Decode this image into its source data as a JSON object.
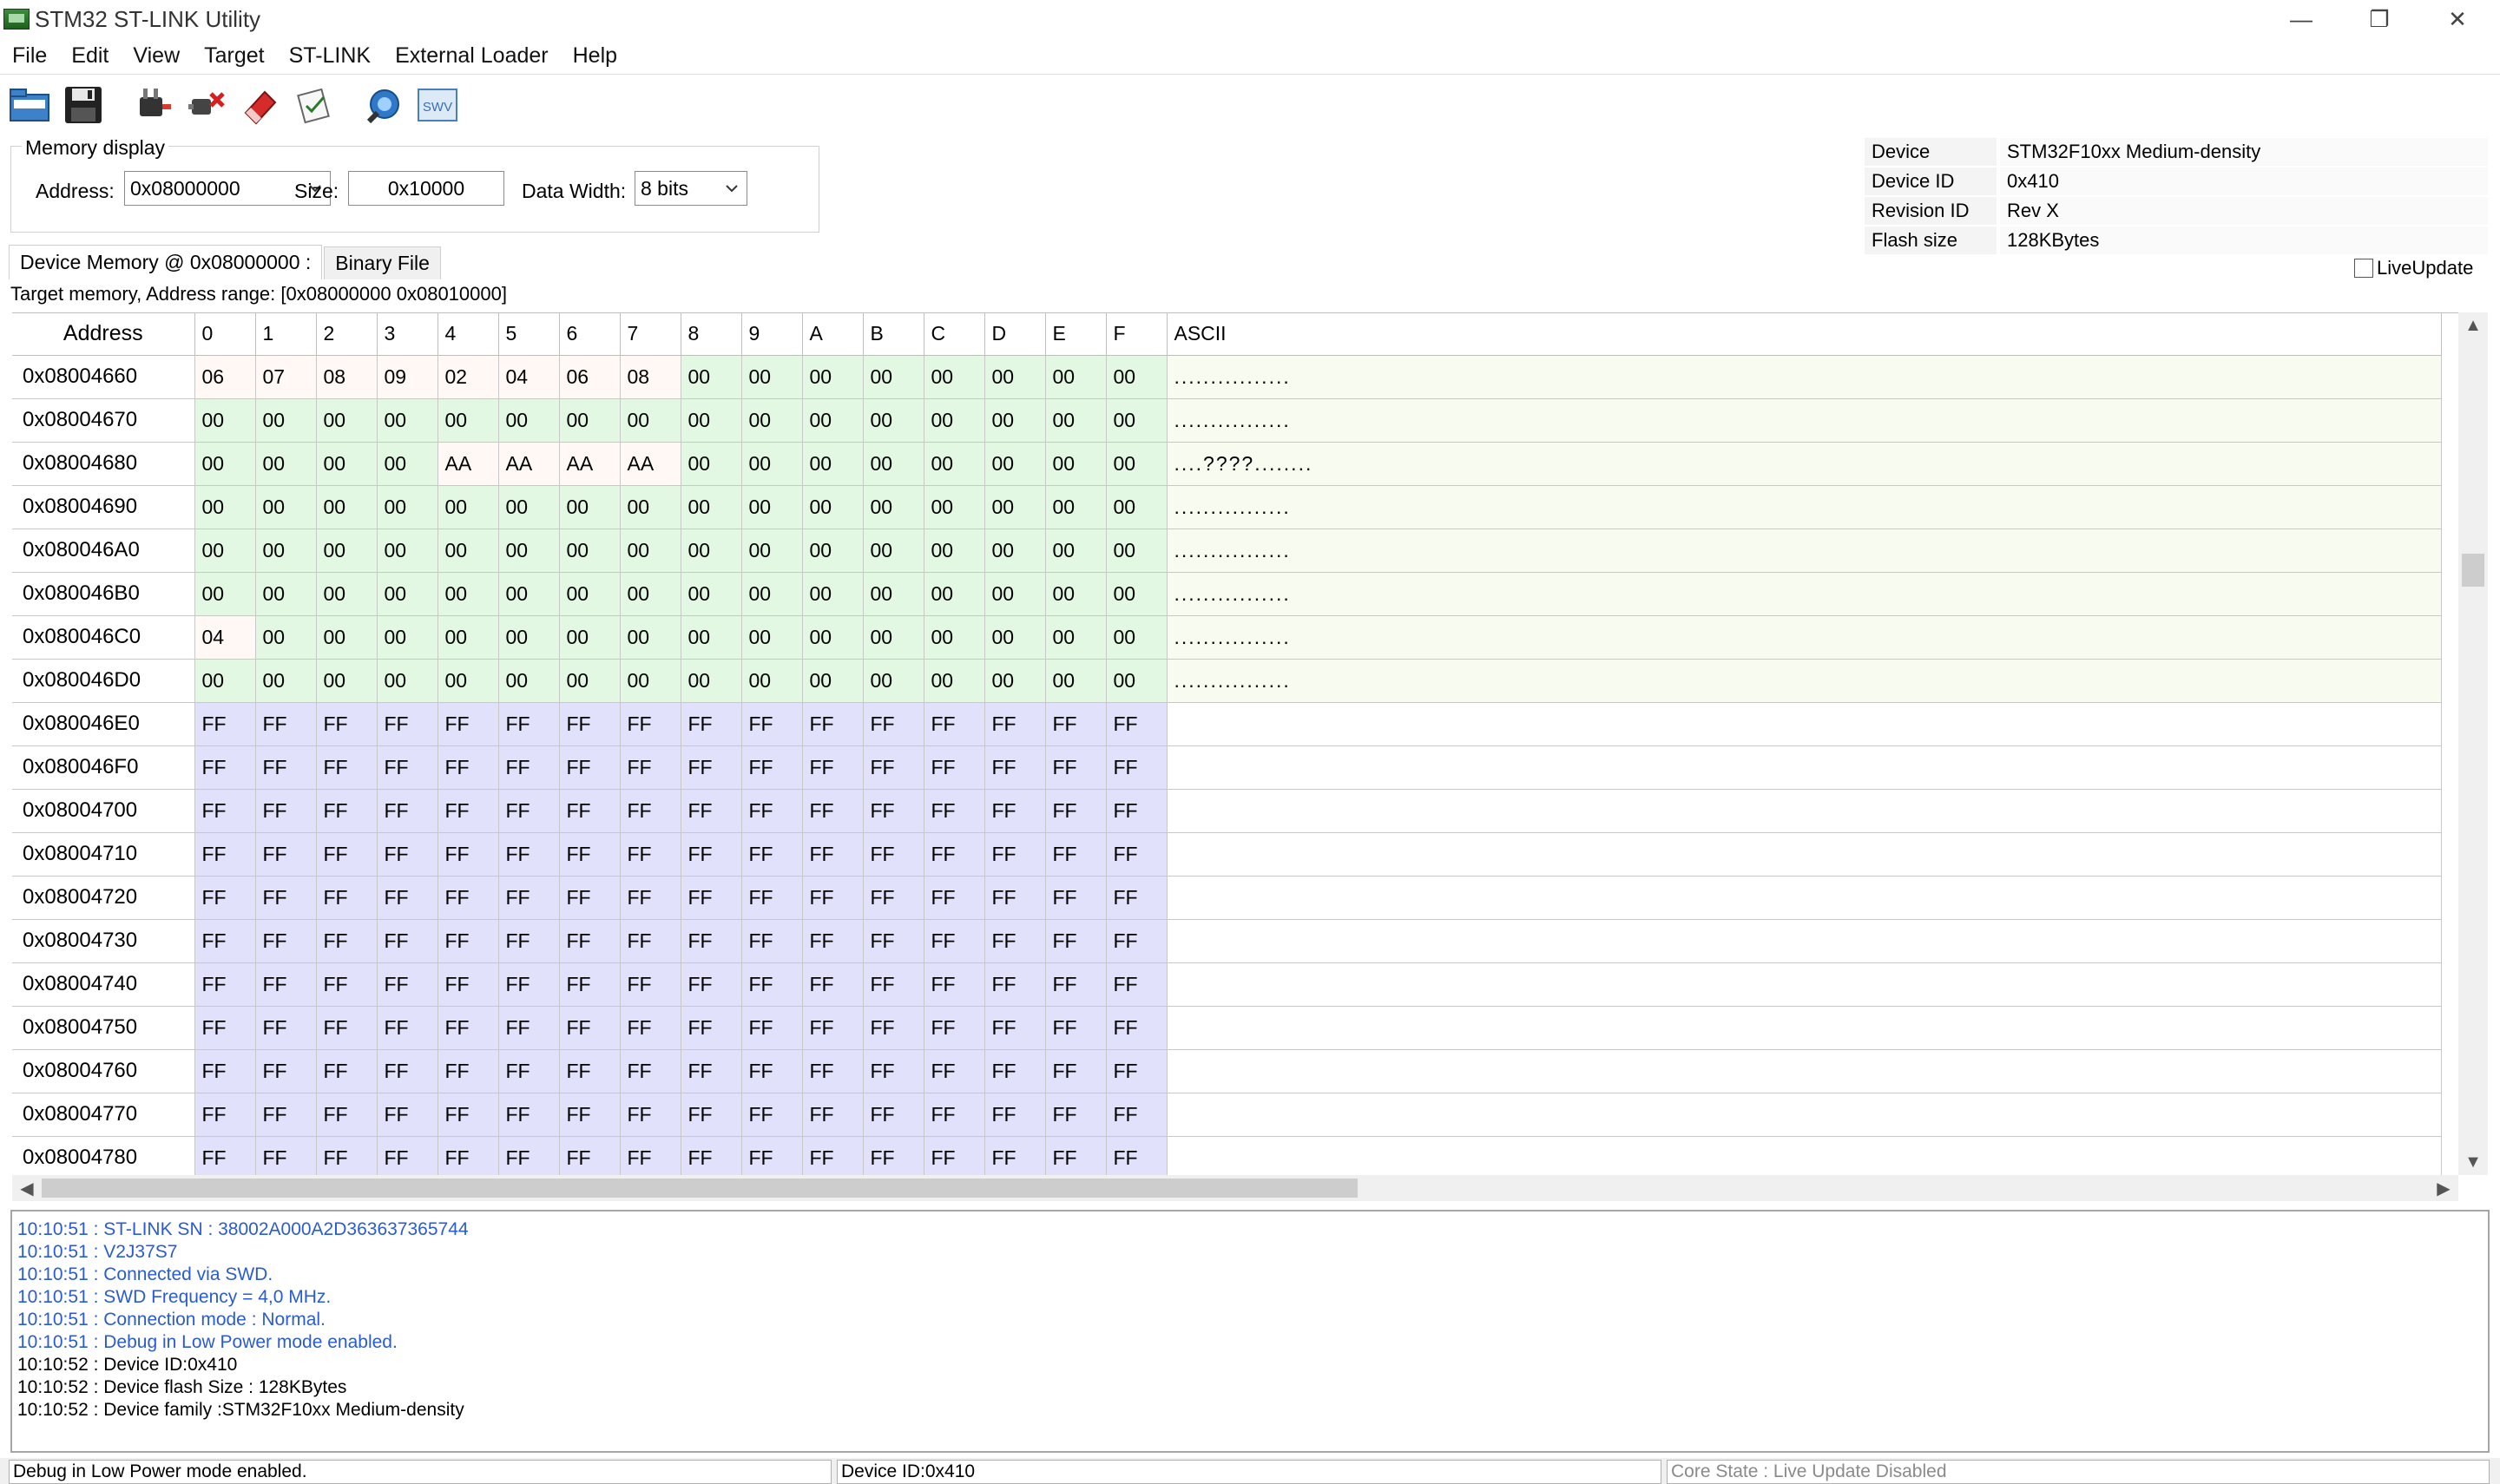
{
  "window": {
    "title": "STM32 ST-LINK Utility",
    "controls": {
      "minimize": "—",
      "restore": "❐",
      "close": "✕"
    }
  },
  "menu": [
    "File",
    "Edit",
    "View",
    "Target",
    "ST-LINK",
    "External Loader",
    "Help"
  ],
  "toolbar": {
    "buttons": [
      "open-file",
      "save-file",
      "connect",
      "disconnect",
      "erase",
      "program",
      "settings",
      "swv"
    ],
    "swv_label": "SWV"
  },
  "memory_display": {
    "legend": "Memory display",
    "address_label": "Address:",
    "address_value": "0x08000000",
    "size_label": "Size:",
    "size_value": "0x10000",
    "width_label": "Data Width:",
    "width_value": "8 bits"
  },
  "device_info": [
    {
      "key": "Device",
      "value": "STM32F10xx Medium-density"
    },
    {
      "key": "Device ID",
      "value": "0x410"
    },
    {
      "key": "Revision ID",
      "value": "Rev X"
    },
    {
      "key": "Flash size",
      "value": "128KBytes"
    }
  ],
  "live_update": {
    "label": "LiveUpdate",
    "checked": false
  },
  "tabs": [
    {
      "label": "Device Memory @ 0x08000000 :",
      "active": true
    },
    {
      "label": "Binary File",
      "active": false
    }
  ],
  "range_text": "Target memory, Address range: [0x08000000 0x08010000]",
  "grid": {
    "headers": [
      "Address",
      "0",
      "1",
      "2",
      "3",
      "4",
      "5",
      "6",
      "7",
      "8",
      "9",
      "A",
      "B",
      "C",
      "D",
      "E",
      "F",
      "ASCII"
    ],
    "rows": [
      {
        "address": "0x08004660",
        "bytes": [
          "06",
          "07",
          "08",
          "09",
          "02",
          "04",
          "06",
          "08",
          "00",
          "00",
          "00",
          "00",
          "00",
          "00",
          "00",
          "00"
        ],
        "ascii": "................"
      },
      {
        "address": "0x08004670",
        "bytes": [
          "00",
          "00",
          "00",
          "00",
          "00",
          "00",
          "00",
          "00",
          "00",
          "00",
          "00",
          "00",
          "00",
          "00",
          "00",
          "00"
        ],
        "ascii": "................"
      },
      {
        "address": "0x08004680",
        "bytes": [
          "00",
          "00",
          "00",
          "00",
          "AA",
          "AA",
          "AA",
          "AA",
          "00",
          "00",
          "00",
          "00",
          "00",
          "00",
          "00",
          "00"
        ],
        "ascii": "....????........"
      },
      {
        "address": "0x08004690",
        "bytes": [
          "00",
          "00",
          "00",
          "00",
          "00",
          "00",
          "00",
          "00",
          "00",
          "00",
          "00",
          "00",
          "00",
          "00",
          "00",
          "00"
        ],
        "ascii": "................"
      },
      {
        "address": "0x080046A0",
        "bytes": [
          "00",
          "00",
          "00",
          "00",
          "00",
          "00",
          "00",
          "00",
          "00",
          "00",
          "00",
          "00",
          "00",
          "00",
          "00",
          "00"
        ],
        "ascii": "................"
      },
      {
        "address": "0x080046B0",
        "bytes": [
          "00",
          "00",
          "00",
          "00",
          "00",
          "00",
          "00",
          "00",
          "00",
          "00",
          "00",
          "00",
          "00",
          "00",
          "00",
          "00"
        ],
        "ascii": "................"
      },
      {
        "address": "0x080046C0",
        "bytes": [
          "04",
          "00",
          "00",
          "00",
          "00",
          "00",
          "00",
          "00",
          "00",
          "00",
          "00",
          "00",
          "00",
          "00",
          "00",
          "00"
        ],
        "ascii": "................"
      },
      {
        "address": "0x080046D0",
        "bytes": [
          "00",
          "00",
          "00",
          "00",
          "00",
          "00",
          "00",
          "00",
          "00",
          "00",
          "00",
          "00",
          "00",
          "00",
          "00",
          "00"
        ],
        "ascii": "................"
      },
      {
        "address": "0x080046E0",
        "bytes": [
          "FF",
          "FF",
          "FF",
          "FF",
          "FF",
          "FF",
          "FF",
          "FF",
          "FF",
          "FF",
          "FF",
          "FF",
          "FF",
          "FF",
          "FF",
          "FF"
        ],
        "ascii": ""
      },
      {
        "address": "0x080046F0",
        "bytes": [
          "FF",
          "FF",
          "FF",
          "FF",
          "FF",
          "FF",
          "FF",
          "FF",
          "FF",
          "FF",
          "FF",
          "FF",
          "FF",
          "FF",
          "FF",
          "FF"
        ],
        "ascii": ""
      },
      {
        "address": "0x08004700",
        "bytes": [
          "FF",
          "FF",
          "FF",
          "FF",
          "FF",
          "FF",
          "FF",
          "FF",
          "FF",
          "FF",
          "FF",
          "FF",
          "FF",
          "FF",
          "FF",
          "FF"
        ],
        "ascii": ""
      },
      {
        "address": "0x08004710",
        "bytes": [
          "FF",
          "FF",
          "FF",
          "FF",
          "FF",
          "FF",
          "FF",
          "FF",
          "FF",
          "FF",
          "FF",
          "FF",
          "FF",
          "FF",
          "FF",
          "FF"
        ],
        "ascii": ""
      },
      {
        "address": "0x08004720",
        "bytes": [
          "FF",
          "FF",
          "FF",
          "FF",
          "FF",
          "FF",
          "FF",
          "FF",
          "FF",
          "FF",
          "FF",
          "FF",
          "FF",
          "FF",
          "FF",
          "FF"
        ],
        "ascii": ""
      },
      {
        "address": "0x08004730",
        "bytes": [
          "FF",
          "FF",
          "FF",
          "FF",
          "FF",
          "FF",
          "FF",
          "FF",
          "FF",
          "FF",
          "FF",
          "FF",
          "FF",
          "FF",
          "FF",
          "FF"
        ],
        "ascii": ""
      },
      {
        "address": "0x08004740",
        "bytes": [
          "FF",
          "FF",
          "FF",
          "FF",
          "FF",
          "FF",
          "FF",
          "FF",
          "FF",
          "FF",
          "FF",
          "FF",
          "FF",
          "FF",
          "FF",
          "FF"
        ],
        "ascii": ""
      },
      {
        "address": "0x08004750",
        "bytes": [
          "FF",
          "FF",
          "FF",
          "FF",
          "FF",
          "FF",
          "FF",
          "FF",
          "FF",
          "FF",
          "FF",
          "FF",
          "FF",
          "FF",
          "FF",
          "FF"
        ],
        "ascii": ""
      },
      {
        "address": "0x08004760",
        "bytes": [
          "FF",
          "FF",
          "FF",
          "FF",
          "FF",
          "FF",
          "FF",
          "FF",
          "FF",
          "FF",
          "FF",
          "FF",
          "FF",
          "FF",
          "FF",
          "FF"
        ],
        "ascii": ""
      },
      {
        "address": "0x08004770",
        "bytes": [
          "FF",
          "FF",
          "FF",
          "FF",
          "FF",
          "FF",
          "FF",
          "FF",
          "FF",
          "FF",
          "FF",
          "FF",
          "FF",
          "FF",
          "FF",
          "FF"
        ],
        "ascii": ""
      },
      {
        "address": "0x08004780",
        "bytes": [
          "FF",
          "FF",
          "FF",
          "FF",
          "FF",
          "FF",
          "FF",
          "FF",
          "FF",
          "FF",
          "FF",
          "FF",
          "FF",
          "FF",
          "FF",
          "FF"
        ],
        "ascii": ""
      }
    ]
  },
  "log": [
    {
      "text": "10:10:51 : ST-LINK SN : 38002A000A2D363637365744",
      "color": "#2a5bd7"
    },
    {
      "text": "10:10:51 : V2J37S7",
      "color": "#2a5bd7"
    },
    {
      "text": "10:10:51 : Connected via SWD.",
      "color": "#2a5bd7"
    },
    {
      "text": "10:10:51 : SWD Frequency = 4,0 MHz.",
      "color": "#2a5bd7"
    },
    {
      "text": "10:10:51 : Connection mode : Normal.",
      "color": "#2a5bd7"
    },
    {
      "text": "10:10:51 : Debug in Low Power mode enabled.",
      "color": "#2a5bd7"
    },
    {
      "text": "10:10:52 : Device ID:0x410",
      "color": "#000000"
    },
    {
      "text": "10:10:52 : Device flash Size : 128KBytes",
      "color": "#000000"
    },
    {
      "text": "10:10:52 : Device family :STM32F10xx Medium-density",
      "color": "#000000"
    }
  ],
  "status": {
    "left": "Debug in Low Power mode enabled.",
    "middle": "Device ID:0x410",
    "right": "Core State : Live Update Disabled"
  },
  "colors": {
    "green_cell": "#e3f8e3",
    "nonzero_cell": "#fff8f4",
    "erased_cell": "#e1e1fb",
    "log_info": "#2a5bd7"
  }
}
